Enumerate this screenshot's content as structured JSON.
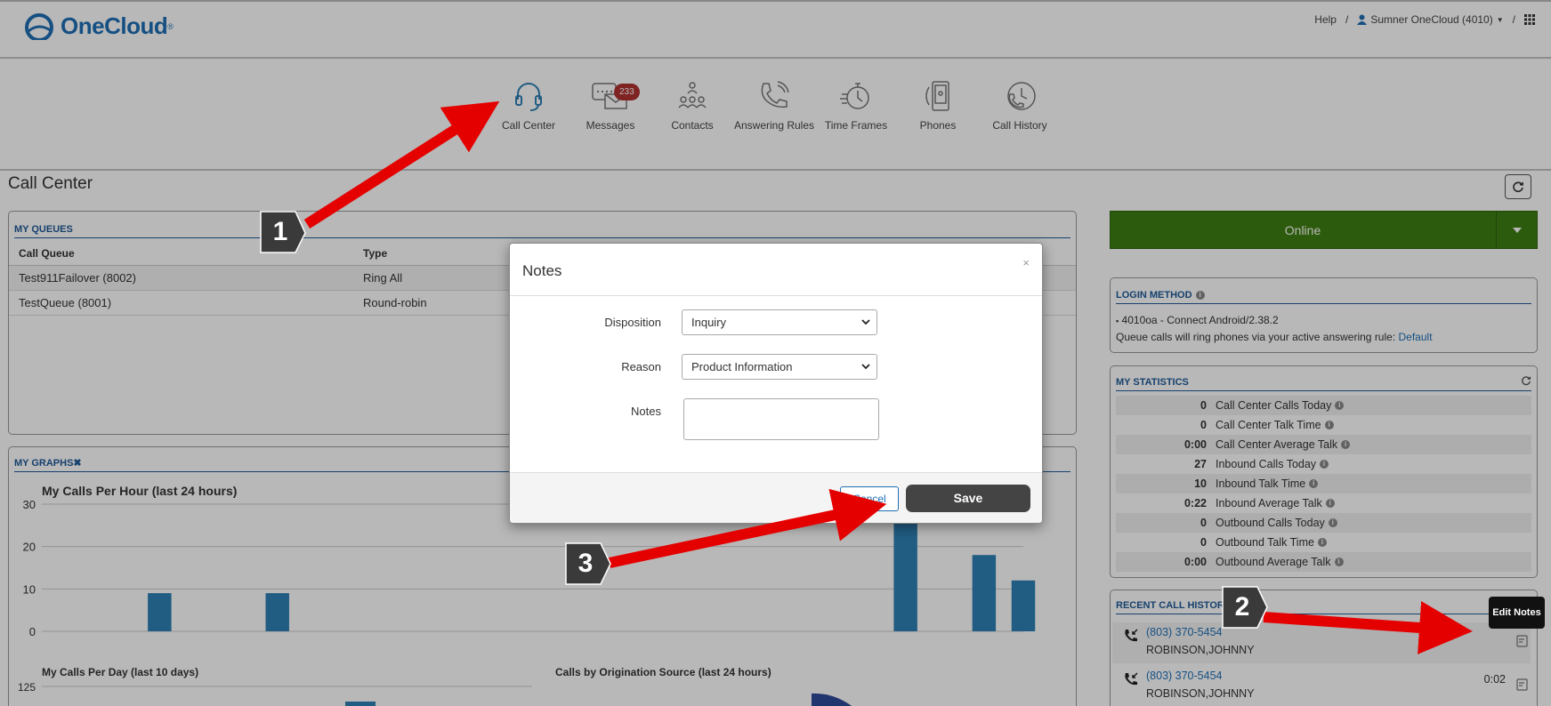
{
  "header": {
    "logo": "OneCloud",
    "help": "Help",
    "user": "Sumner OneCloud (4010)"
  },
  "nav": [
    {
      "label": "Call Center",
      "icon": "headset-icon"
    },
    {
      "label": "Messages",
      "icon": "messages-icon",
      "badge": "233"
    },
    {
      "label": "Contacts",
      "icon": "contacts-icon"
    },
    {
      "label": "Answering Rules",
      "icon": "answering-rules-icon"
    },
    {
      "label": "Time Frames",
      "icon": "time-frames-icon"
    },
    {
      "label": "Phones",
      "icon": "phones-icon"
    },
    {
      "label": "Call History",
      "icon": "call-history-icon"
    }
  ],
  "page_title": "Call Center",
  "queues": {
    "title": "MY QUEUES",
    "columns": [
      "Call Queue",
      "Type"
    ],
    "rows": [
      [
        "Test911Failover (8002)",
        "Ring All"
      ],
      [
        "TestQueue (8001)",
        "Round-robin"
      ]
    ]
  },
  "graphs": {
    "title": "MY GRAPHS",
    "chart_data": [
      {
        "type": "bar",
        "title": "My Calls Per Hour (last 24 hours)",
        "yticks": [
          0,
          10,
          20,
          30
        ],
        "ylim": [
          0,
          30
        ],
        "x": [
          3,
          6,
          22,
          24,
          25
        ],
        "values": [
          9,
          9,
          30,
          18,
          12
        ],
        "bar_color": "#2f80b5"
      },
      {
        "type": "bar",
        "title": "My Calls Per Day (last 10 days)",
        "yticks": [
          125
        ]
      },
      {
        "type": "pie",
        "title": "Calls by Origination Source (last 24 hours)"
      }
    ]
  },
  "status": {
    "label": "Online",
    "color": "#3f7f12"
  },
  "login": {
    "title": "LOGIN METHOD",
    "device": "4010oa - Connect Android/2.38.2",
    "note": "Queue calls will ring phones via your active answering rule:",
    "link": "Default"
  },
  "stats": {
    "title": "MY STATISTICS",
    "rows": [
      {
        "value": "0",
        "label": "Call Center Calls Today"
      },
      {
        "value": "0",
        "label": "Call Center Talk Time"
      },
      {
        "value": "0:00",
        "label": "Call Center Average Talk"
      },
      {
        "value": "27",
        "label": "Inbound Calls Today"
      },
      {
        "value": "10",
        "label": "Inbound Talk Time"
      },
      {
        "value": "0:22",
        "label": "Inbound Average Talk"
      },
      {
        "value": "0",
        "label": "Outbound Calls Today"
      },
      {
        "value": "0",
        "label": "Outbound Talk Time"
      },
      {
        "value": "0:00",
        "label": "Outbound Average Talk"
      }
    ]
  },
  "recent": {
    "title": "RECENT CALL HISTOR",
    "rows": [
      {
        "number": "(803) 370-5454",
        "name": "ROBINSON,JOHNNY",
        "duration": ""
      },
      {
        "number": "(803) 370-5454",
        "name": "ROBINSON,JOHNNY",
        "duration": "0:02"
      }
    ]
  },
  "tooltip": "Edit Notes",
  "modal": {
    "title": "Notes",
    "close": "×",
    "disposition_label": "Disposition",
    "disposition_value": "Inquiry",
    "reason_label": "Reason",
    "reason_value": "Product Information",
    "notes_label": "Notes",
    "cancel": "Cancel",
    "save": "Save"
  },
  "steps": [
    "1",
    "2",
    "3"
  ]
}
